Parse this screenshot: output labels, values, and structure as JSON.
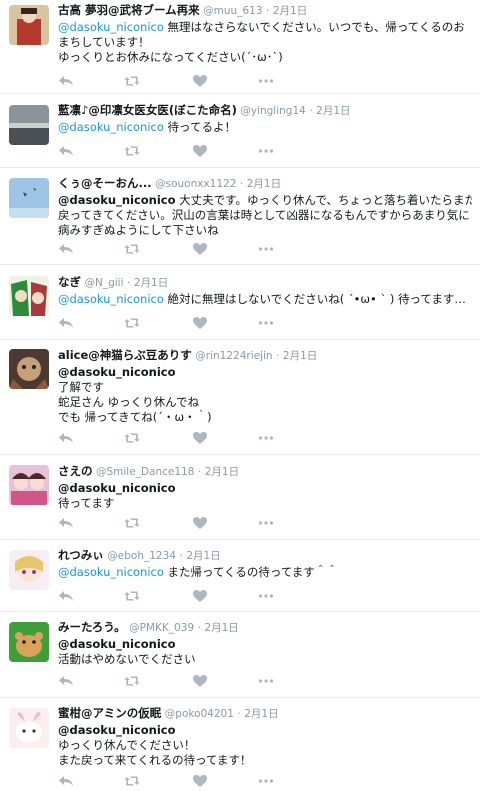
{
  "colors": {
    "icon": "#aab8c2",
    "mention": "#1b95e0",
    "muted": "#8899a6",
    "divider": "#e6ecf0"
  },
  "icons": {
    "reply": "reply-icon",
    "retweet": "retweet-icon",
    "like": "heart-icon",
    "more": "more-icon"
  },
  "tweets": [
    {
      "name": "古高 夢羽@武将ブーム再来",
      "handle": "@muu_613",
      "time": "2月1日",
      "mention": "@dasoku_niconico",
      "mention_bold": false,
      "after_mention": " 無理はなさらないでください。いつでも、帰ってくるのお",
      "lines": [
        "まちしています！",
        "ゆっくりとお休みになってください(´･ω･`)"
      ]
    },
    {
      "name": "藍凛♪@印凛女医女医(ぼこた命名)",
      "handle": "@yingling14",
      "time": "2月1日",
      "mention": "@dasoku_niconico",
      "mention_bold": false,
      "after_mention": " 待ってるよ！",
      "lines": []
    },
    {
      "name": "くぅ@そーおん...",
      "handle": "@souonxx1122",
      "time": "2月1日",
      "mention": "@dasoku_niconico",
      "mention_bold": true,
      "after_mention": " 大丈夫です。ゆっくり休んで、ちょっと落ち着いたらまた",
      "lines": [
        "戻ってきてください。沢山の言葉は時として凶器になるもんですからあまり気に",
        "病みすぎぬようにして下さいね"
      ]
    },
    {
      "name": "なぎ",
      "handle": "@N_giii",
      "time": "2月1日",
      "mention": "@dasoku_niconico",
      "mention_bold": false,
      "after_mention": " 絶対に無理はしないでくださいね( ´•ω• ` ) 待ってます…",
      "lines": []
    },
    {
      "name": "alice@神猫らぶ豆ありす",
      "handle": "@rin1224riejin",
      "time": "2月1日",
      "mention": "@dasoku_niconico",
      "mention_bold": false,
      "after_mention": "",
      "lines": [
        "了解です",
        "蛇足さん ゆっくり休んでね",
        "でも 帰ってきてね(´・ω・｀)"
      ]
    },
    {
      "name": "さえの",
      "handle": "@Smile_Dance118",
      "time": "2月1日",
      "mention": "@dasoku_niconico",
      "mention_bold": true,
      "after_mention": "",
      "lines": [
        "待ってます"
      ]
    },
    {
      "name": "れつみぃ",
      "handle": "@eboh_1234",
      "time": "2月1日",
      "mention": "@dasoku_niconico",
      "mention_bold": false,
      "after_mention": " また帰ってくるの待ってます＾＾",
      "lines": []
    },
    {
      "name": "みーたろう。",
      "handle": "@PMKK_039",
      "time": "2月1日",
      "mention": "@dasoku_niconico",
      "mention_bold": true,
      "after_mention": "",
      "lines": [
        "活動はやめないでください"
      ]
    },
    {
      "name": "蜜柑@アミンの仮眠",
      "handle": "@poko04201",
      "time": "2月1日",
      "mention": "@dasoku_niconico",
      "mention_bold": true,
      "after_mention": "",
      "lines": [
        "ゆっくり休んでください！",
        "また戻って来てくれるの待ってます！"
      ]
    }
  ]
}
